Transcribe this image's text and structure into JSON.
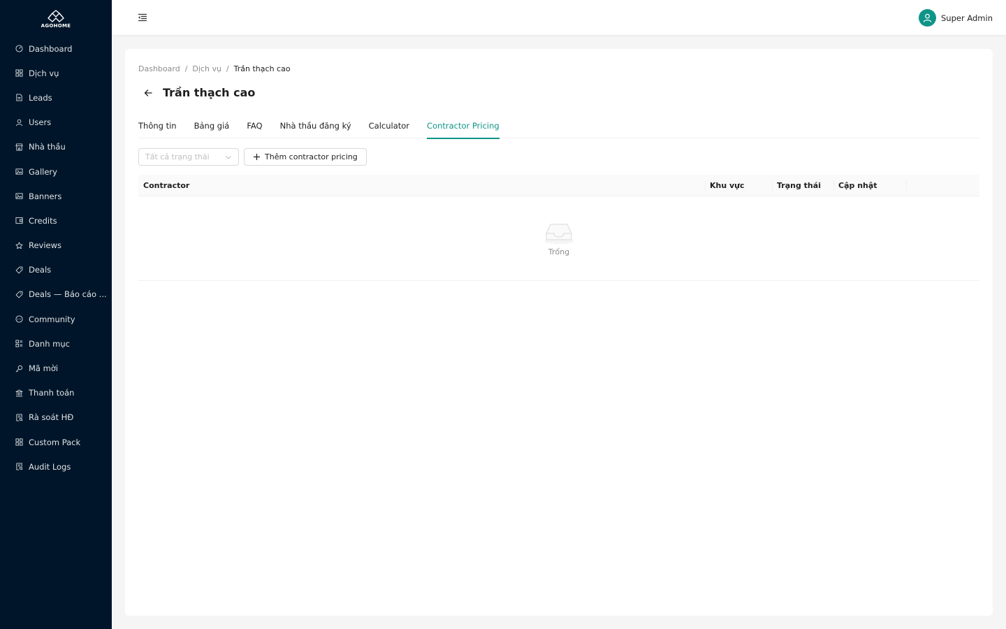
{
  "app": {
    "logo_text": "AGOHOME"
  },
  "sidebar": {
    "items": [
      {
        "label": "Dashboard",
        "icon": "dashboard-icon"
      },
      {
        "label": "Dịch vụ",
        "icon": "appstore-icon"
      },
      {
        "label": "Leads",
        "icon": "file-icon"
      },
      {
        "label": "Users",
        "icon": "user-icon"
      },
      {
        "label": "Nhà thầu",
        "icon": "shop-icon"
      },
      {
        "label": "Gallery",
        "icon": "picture-icon"
      },
      {
        "label": "Banners",
        "icon": "picture-icon"
      },
      {
        "label": "Credits",
        "icon": "wallet-icon"
      },
      {
        "label": "Reviews",
        "icon": "star-icon"
      },
      {
        "label": "Deals",
        "icon": "tag-icon"
      },
      {
        "label": "Deals — Báo cáo ...",
        "icon": "tag-icon"
      },
      {
        "label": "Community",
        "icon": "message-icon"
      },
      {
        "label": "Danh mục",
        "icon": "category-icon"
      },
      {
        "label": "Mã mời",
        "icon": "key-icon"
      },
      {
        "label": "Thanh toán",
        "icon": "bank-icon"
      },
      {
        "label": "Rà soát HĐ",
        "icon": "audit-icon"
      },
      {
        "label": "Custom Pack",
        "icon": "appstore-icon"
      },
      {
        "label": "Audit Logs",
        "icon": "audit-icon"
      }
    ]
  },
  "header": {
    "user_name": "Super Admin"
  },
  "breadcrumb": [
    "Dashboard",
    "Dịch vụ",
    "Trần thạch cao"
  ],
  "page": {
    "title": "Trần thạch cao"
  },
  "tabs": [
    {
      "label": "Thông tin",
      "active": false
    },
    {
      "label": "Bảng giá",
      "active": false
    },
    {
      "label": "FAQ",
      "active": false
    },
    {
      "label": "Nhà thầu đăng ký",
      "active": false
    },
    {
      "label": "Calculator",
      "active": false
    },
    {
      "label": "Contractor Pricing",
      "active": true
    }
  ],
  "toolbar": {
    "status_placeholder": "Tất cả trạng thái",
    "add_label": "Thêm contractor pricing"
  },
  "table": {
    "columns": [
      "Contractor",
      "Khu vực",
      "Trạng thái",
      "Cập nhật",
      ""
    ],
    "empty_text": "Trống"
  },
  "colors": {
    "sidebar_bg": "#001529",
    "accent": "#0f9488"
  }
}
